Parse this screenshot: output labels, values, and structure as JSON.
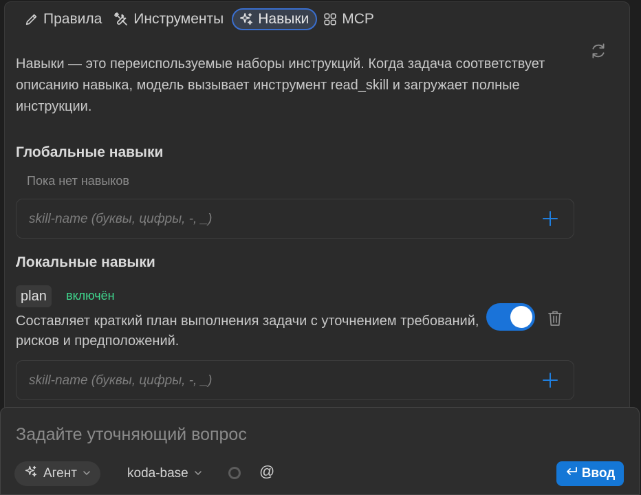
{
  "tabs": [
    {
      "label": "Правила",
      "icon": "pencil-icon",
      "active": false
    },
    {
      "label": "Инструменты",
      "icon": "tools-icon",
      "active": false
    },
    {
      "label": "Навыки",
      "icon": "sparkles-icon",
      "active": true
    },
    {
      "label": "MCP",
      "icon": "grid-icon",
      "active": false
    }
  ],
  "description": "Навыки — это переиспользуемые наборы инструкций. Когда задача соответствует описанию навыка, модель вызывает инструмент read_skill и загружает полные инструкции.",
  "global_skills": {
    "title": "Глобальные навыки",
    "empty_text": "Пока нет навыков",
    "input_placeholder": "skill-name (буквы, цифры, -, _)"
  },
  "local_skills": {
    "title": "Локальные навыки",
    "items": [
      {
        "name": "plan",
        "status": "включён",
        "description": "Составляет краткий план выполнения задачи с уточнением требований, рисков и предположений.",
        "enabled": true
      }
    ],
    "input_placeholder": "skill-name (буквы, цифры, -, _)"
  },
  "composer": {
    "placeholder": "Задайте уточняющий вопрос",
    "agent_label": "Агент",
    "model_label": "koda-base",
    "mention_symbol": "@",
    "send_label": "Ввод"
  },
  "colors": {
    "accent": "#1577d6",
    "status_enabled": "#3fd68d",
    "active_tab_border": "#3a6fd0"
  }
}
